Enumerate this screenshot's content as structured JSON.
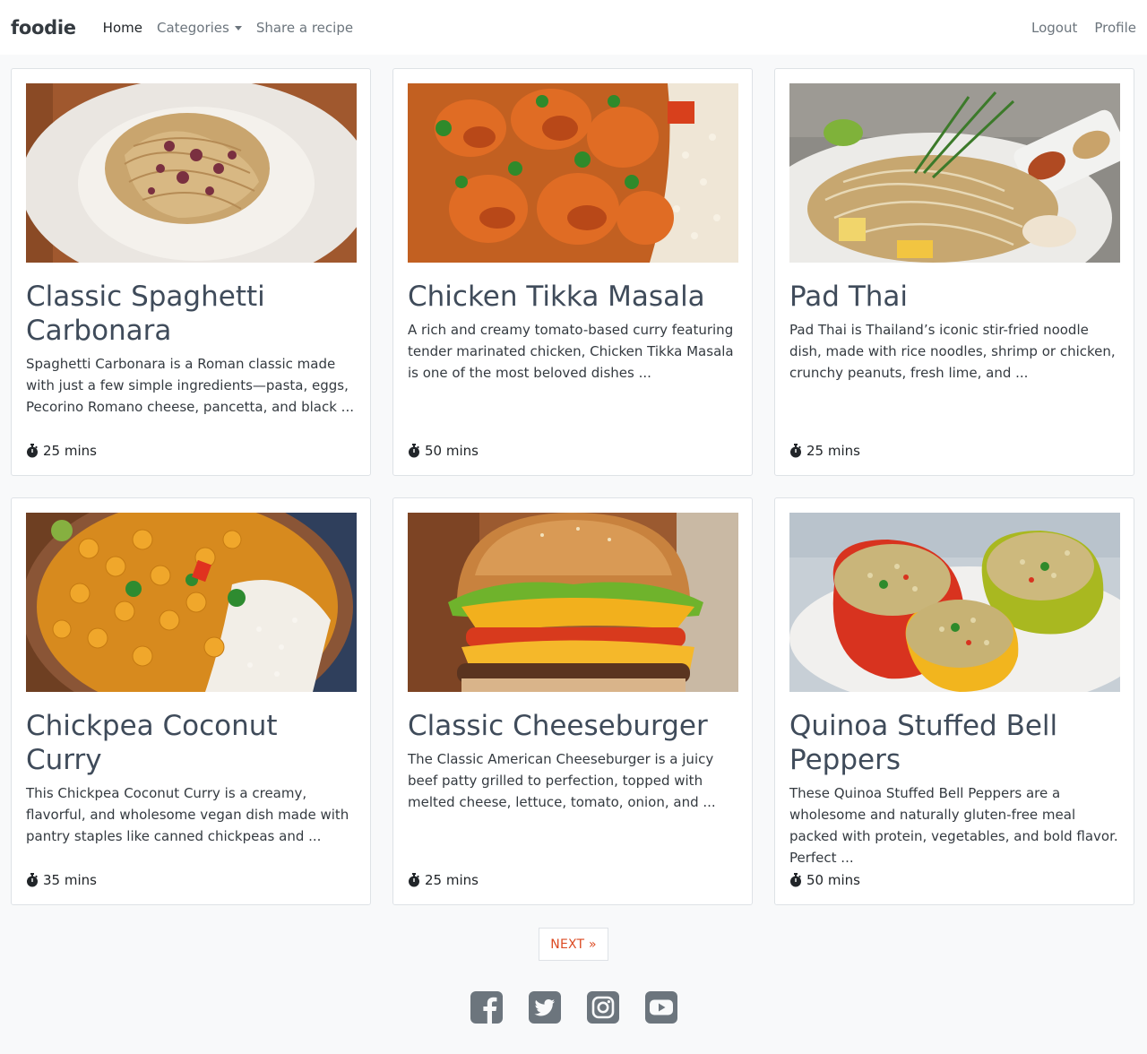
{
  "nav": {
    "brand": "foodie",
    "home": "Home",
    "categories": "Categories",
    "share": "Share a recipe",
    "logout": "Logout",
    "profile": "Profile"
  },
  "recipes": [
    {
      "title": "Classic Spaghetti Carbonara",
      "description": "Spaghetti Carbonara is a Roman classic made with just a few simple ingredients—pasta, eggs, Pecorino Romano cheese, pancetta, and black ...",
      "time": "25 mins",
      "image_icon": "carbonara-photo"
    },
    {
      "title": "Chicken Tikka Masala",
      "description": "A rich and creamy tomato-based curry featuring tender marinated chicken, Chicken Tikka Masala is one of the most beloved dishes ...",
      "time": "50 mins",
      "image_icon": "tikka-masala-photo"
    },
    {
      "title": "Pad Thai",
      "description": "Pad Thai is Thailand’s iconic stir-fried noodle dish, made with rice noodles, shrimp or chicken, crunchy peanuts, fresh lime, and ...",
      "time": "25 mins",
      "image_icon": "pad-thai-photo"
    },
    {
      "title": "Chickpea Coconut Curry",
      "description": "This Chickpea Coconut Curry is a creamy, flavorful, and wholesome vegan dish made with pantry staples like canned chickpeas and ...",
      "time": "35 mins",
      "image_icon": "chickpea-curry-photo"
    },
    {
      "title": "Classic Cheeseburger",
      "description": "The Classic American Cheeseburger is a juicy beef patty grilled to perfection, topped with melted cheese, lettuce, tomato, onion, and ...",
      "time": "25 mins",
      "image_icon": "cheeseburger-photo"
    },
    {
      "title": "Quinoa Stuffed Bell Peppers",
      "description": "These Quinoa Stuffed Bell Peppers are a wholesome and naturally gluten-free meal packed with protein, vegetables, and bold flavor. Perfect ...",
      "time": "50 mins",
      "image_icon": "stuffed-peppers-photo"
    }
  ],
  "pagination": {
    "next": "NEXT »"
  },
  "social": [
    "facebook-icon",
    "twitter-icon",
    "instagram-icon",
    "youtube-icon"
  ],
  "colors": {
    "accent": "#dc4b23",
    "title": "#3f4b5a",
    "background": "#f8f9fa",
    "social_icon": "#6c757d"
  }
}
